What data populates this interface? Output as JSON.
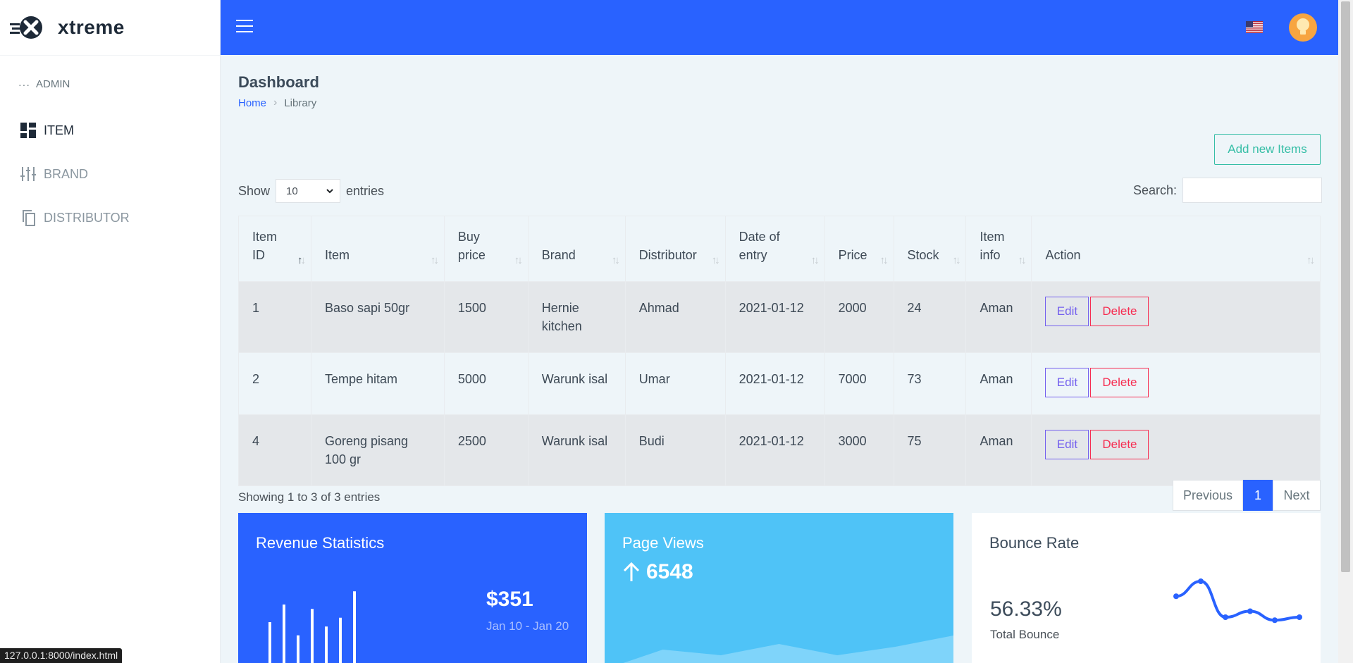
{
  "brand": {
    "name": "xtreme"
  },
  "sidebar": {
    "caption": "ADMIN",
    "items": [
      {
        "label": "ITEM",
        "icon": "dashboard-icon",
        "active": true
      },
      {
        "label": "BRAND",
        "icon": "tune-icon",
        "active": false
      },
      {
        "label": "DISTRIBUTOR",
        "icon": "copy-icon",
        "active": false
      }
    ]
  },
  "topbar": {
    "menu_icon": "hamburger-icon",
    "language_flag": "us-flag-icon",
    "profile_icon": "lightbulb-avatar-icon"
  },
  "page": {
    "title": "Dashboard",
    "breadcrumb": {
      "home": "Home",
      "current": "Library"
    },
    "add_button": "Add new Items"
  },
  "table_controls": {
    "show_label": "Show",
    "entries_value": "10",
    "entries_label": "entries",
    "search_label": "Search:",
    "search_value": ""
  },
  "table": {
    "headers": [
      {
        "label": "Item ID",
        "sorted": "asc"
      },
      {
        "label": "Item",
        "sorted": "none"
      },
      {
        "label": "Buy price",
        "sorted": "none"
      },
      {
        "label": "Brand",
        "sorted": "none"
      },
      {
        "label": "Distributor",
        "sorted": "none"
      },
      {
        "label": "Date of entry",
        "sorted": "none"
      },
      {
        "label": "Price",
        "sorted": "none"
      },
      {
        "label": "Stock",
        "sorted": "none"
      },
      {
        "label": "Item info",
        "sorted": "none"
      },
      {
        "label": "Action",
        "sorted": "none"
      }
    ],
    "rows": [
      {
        "id": "1",
        "item": "Baso sapi 50gr",
        "buy_price": "1500",
        "brand": "Hernie kitchen",
        "distributor": "Ahmad",
        "date": "2021-01-12",
        "price": "2000",
        "stock": "24",
        "info": "Aman"
      },
      {
        "id": "2",
        "item": "Tempe hitam",
        "buy_price": "5000",
        "brand": "Warunk isal",
        "distributor": "Umar",
        "date": "2021-01-12",
        "price": "7000",
        "stock": "73",
        "info": "Aman"
      },
      {
        "id": "4",
        "item": "Goreng pisang 100 gr",
        "buy_price": "2500",
        "brand": "Warunk isal",
        "distributor": "Budi",
        "date": "2021-01-12",
        "price": "3000",
        "stock": "75",
        "info": "Aman"
      }
    ],
    "edit_label": "Edit",
    "delete_label": "Delete"
  },
  "table_footer": {
    "info": "Showing 1 to 3 of 3 entries",
    "previous": "Previous",
    "current_page": "1",
    "next": "Next"
  },
  "cards": {
    "revenue": {
      "title": "Revenue Statistics",
      "amount": "$351",
      "range": "Jan 10 - Jan 20",
      "bars": [
        0.6,
        0.8,
        0.45,
        0.75,
        0.55,
        0.65,
        0.95
      ]
    },
    "page_views": {
      "title": "Page Views",
      "value": "6548",
      "area": [
        0.1,
        0.45,
        0.35,
        0.55,
        0.35,
        0.5,
        0.7
      ]
    },
    "bounce": {
      "title": "Bounce Rate",
      "value": "56.33%",
      "label": "Total Bounce",
      "line": [
        0.55,
        0.8,
        0.2,
        0.3,
        0.15,
        0.2
      ]
    }
  },
  "colors": {
    "primary": "#2962ff",
    "info": "#4fc3f7",
    "success": "#36bea6",
    "edit": "#7460ee",
    "danger": "#f62d51"
  },
  "status_bar": {
    "url": "127.0.0.1:8000/index.html"
  }
}
